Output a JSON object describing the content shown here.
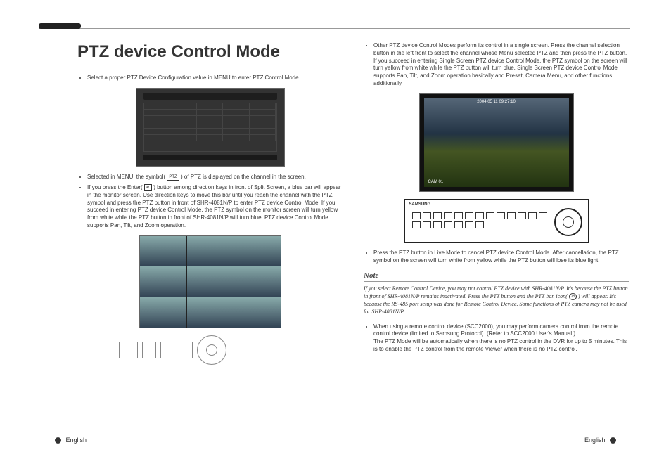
{
  "title": "PTZ device Control Mode",
  "left": {
    "p1": "Select a proper PTZ Device Configuration value in MENU to enter PTZ Control Mode.",
    "p2_a": "Selected in MENU, the symbol(",
    "p2_icon": "PTZ",
    "p2_b": ") of PTZ is displayed on the channel in the screen.",
    "p3_a": "If you press the Enter(",
    "p3_icon": "↵",
    "p3_b": ") button among direction keys in front of Split Screen, a blue bar will appear in the monitor screen. Use direction keys to move this bar until you reach the channel with the PTZ symbol and press the PTZ button in front of SHR-4081N/P to enter PTZ device Control Mode. If you succeed in entering PTZ device Control Mode, the PTZ symbol on the monitor screen will turn yellow from white while the PTZ button in front of SHR-4081N/P will turn blue. PTZ device Control Mode supports Pan, Tilt, and Zoom operation."
  },
  "right": {
    "p1": "Other PTZ device Control Modes perform its control in a single screen. Press the channel selection button in the left front to select the channel whose Menu selected PTZ and then press the PTZ button. If you succeed in entering Single Screen PTZ device Control Mode, the PTZ symbol on the screen will turn yellow from white while the PTZ button will turn blue. Single Screen PTZ device Control Mode supports Pan, Tilt, and Zoom operation basically and Preset, Camera Menu, and other functions additionally.",
    "shot_ts": "2004 05 11    09:27:10",
    "shot_cam": "CAM 01",
    "device_brand": "SAMSUNG",
    "p2": "Press the PTZ button in Live Mode to cancel PTZ device Control Mode. After cancellation, the PTZ symbol on the screen will turn white from yellow while the PTZ button will lose its blue light.",
    "note_hdr": "Note",
    "note_a": "If you select Remote Control Device, you may not control PTZ device with SHR-4081N/P. It's because the PTZ button in front of SHR-4081N/P remains inactivated. Press the PTZ button and the PTZ ban icon(",
    "note_icon": "⊘",
    "note_b": ") will appear. It's because the RS-485 port setup was done for Remote Control Device. Some functions of PTZ camera may not be used for SHR-4081N/P.",
    "p3": "When using a remote control device (SCC2000), you may perform camera control from the remote control device (limited to Samsung Protocol). (Refer to SCC2000 User's Manual.)\nThe PTZ Mode will be automatically when there is no PTZ control in the DVR for up to 5 minutes. This is to enable the PTZ control from the remote Viewer when there is no PTZ control."
  },
  "footer": "English"
}
